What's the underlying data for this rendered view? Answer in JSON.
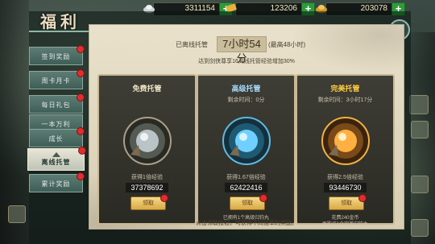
{
  "currency": [
    {
      "icon": "silver-ingot-icon",
      "value": "3311154",
      "plus": "+"
    },
    {
      "icon": "gold-bar-icon",
      "value": "123206",
      "plus": "+"
    },
    {
      "icon": "gold-ingot-icon",
      "value": "203078",
      "plus": "+"
    }
  ],
  "panel": {
    "title": "福利",
    "close": "✕"
  },
  "tabs": [
    {
      "label": "签到奖励",
      "badge": true
    },
    {
      "label": "周卡月卡",
      "badge": true
    },
    {
      "label": "每日礼包",
      "badge": true
    },
    {
      "label": "一本万利",
      "badge": false
    },
    {
      "label": "成长",
      "badge": true
    },
    {
      "label": "离线托管",
      "badge": true,
      "active": true
    },
    {
      "label": "累计奖励",
      "badge": true
    }
  ],
  "offline": {
    "label": "已离线托管",
    "time": "7小时54分",
    "max": "(最高48小时)",
    "vip_note": "达到剑侠尊享16离线托管经验增加30%",
    "footer": "点击领取按钮，可获得不同倍率的奖励。"
  },
  "cards": [
    {
      "title": "免费托管",
      "title_color": "#f0e6c8",
      "remaining": "",
      "gain": "获得1倍经验",
      "value": "37378692",
      "button": "领取",
      "note": "",
      "note2": "",
      "orb": "#e8e0d0"
    },
    {
      "title": "高级托管",
      "title_color": "#a9dcff",
      "remaining": "剩余时间：0分",
      "gain": "获得1.67倍经验",
      "value": "62422416",
      "button": "领取",
      "note": "已拥有1个高级归钧丸",
      "note2": "",
      "orb": "#6fd0ff"
    },
    {
      "title": "完美托管",
      "title_color": "#ffcc40",
      "remaining": "剩余时间：3小时17分",
      "gain": "获得2.5倍经验",
      "value": "93446730",
      "button": "领取",
      "note": "花费240金币",
      "note2": "再购买1个完美归钧丸",
      "orb": "#ffb040"
    }
  ]
}
